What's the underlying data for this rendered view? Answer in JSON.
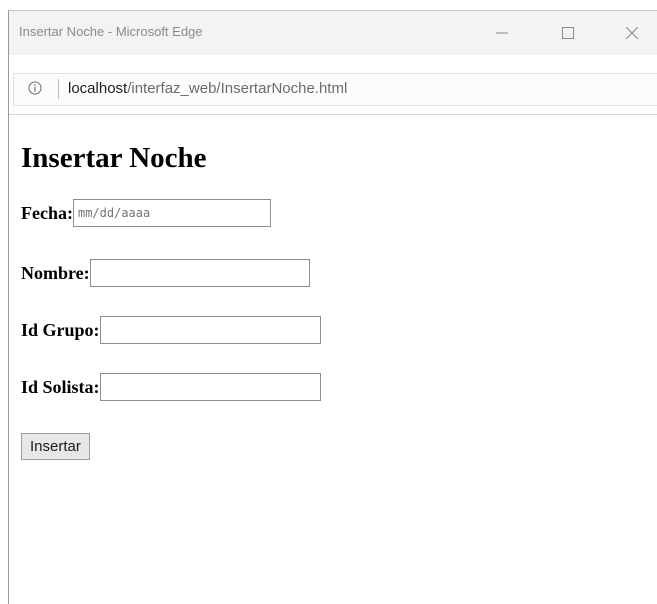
{
  "window": {
    "title": "Insertar Noche - Microsoft Edge"
  },
  "address_bar": {
    "host": "localhost",
    "path": "/interfaz_web/InsertarNoche.html"
  },
  "page": {
    "heading": "Insertar Noche",
    "fields": {
      "fecha": {
        "label": "Fecha:",
        "placeholder": "mm/dd/aaaa",
        "value": ""
      },
      "nombre": {
        "label": "Nombre:",
        "value": ""
      },
      "id_grupo": {
        "label": "Id Grupo:",
        "value": ""
      },
      "id_solista": {
        "label": "Id Solista:",
        "value": ""
      }
    },
    "submit_label": "Insertar"
  },
  "icons": {
    "info": "info-icon",
    "minimize": "minimize-icon",
    "maximize": "maximize-icon",
    "close": "close-icon"
  }
}
